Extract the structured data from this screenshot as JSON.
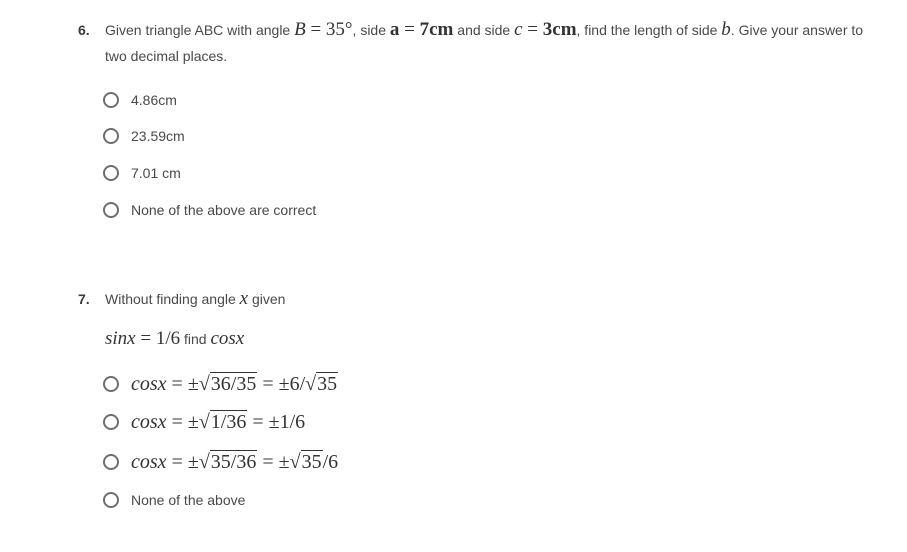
{
  "questions": [
    {
      "number": "6.",
      "text_parts": {
        "p1": "Given triangle ABC with angle ",
        "math_B": "B = 35°",
        "p2": ", side ",
        "math_a_var": "a",
        "math_a_eq": " = ",
        "math_a_val": "7cm",
        "p3": " and side ",
        "math_c_var": "c",
        "math_c_eq": " = ",
        "math_c_val": "3cm",
        "p4": ", find the length of side ",
        "math_b": "b",
        "p5": ". Give your answer to two decimal places."
      },
      "options": [
        {
          "label": "4.86cm",
          "selected": false
        },
        {
          "label": "23.59cm",
          "selected": false
        },
        {
          "label": "7.01 cm",
          "selected": false
        },
        {
          "label": "None of the above are correct",
          "selected": false
        }
      ]
    },
    {
      "number": "7.",
      "text_parts": {
        "p1": "Without finding angle ",
        "math_x": "x",
        "p2": " given",
        "given_lhs": "sinx",
        "given_eq": " = 1/6",
        "given_find": " find ",
        "given_target": "cosx"
      },
      "options": [
        {
          "lhs": "cosx",
          "eq": " = ±",
          "rad": "36/35",
          "mid": " = ±6/",
          "rad2": "35",
          "tail": "",
          "selected": false
        },
        {
          "lhs": "cosx",
          "eq": " = ±",
          "rad": "1/36",
          "mid": " = ±1/6",
          "rad2": "",
          "tail": "",
          "selected": false
        },
        {
          "lhs": "cosx",
          "eq": " = ±",
          "rad": "35/36",
          "mid": " = ±",
          "rad2": "35",
          "tail": "/6",
          "selected": false
        },
        {
          "label": "None of the above",
          "selected": false
        }
      ]
    }
  ]
}
